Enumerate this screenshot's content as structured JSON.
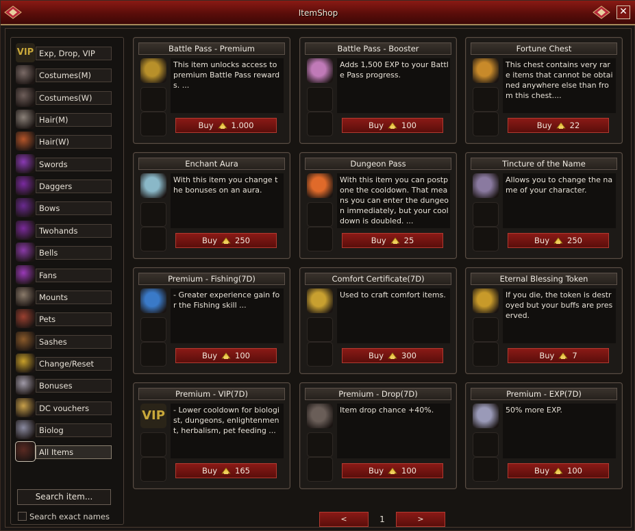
{
  "window": {
    "title": "ItemShop",
    "close_glyph": "✕"
  },
  "sidebar": {
    "categories": [
      {
        "label": "Exp, Drop, VIP",
        "icon": "vip-icon",
        "color": "#c9a83a",
        "text": "VIP"
      },
      {
        "label": "Costumes(M)",
        "icon": "costume-male-icon",
        "color": "#7a6a66"
      },
      {
        "label": "Costumes(W)",
        "icon": "costume-female-icon",
        "color": "#6e5e5a"
      },
      {
        "label": "Hair(M)",
        "icon": "hair-male-icon",
        "color": "#8a8078"
      },
      {
        "label": "Hair(W)",
        "icon": "hair-female-icon",
        "color": "#b4552a"
      },
      {
        "label": "Swords",
        "icon": "sword-icon",
        "color": "#8a3ab4"
      },
      {
        "label": "Daggers",
        "icon": "dagger-icon",
        "color": "#7a2aa0"
      },
      {
        "label": "Bows",
        "icon": "bow-icon",
        "color": "#6a2a90"
      },
      {
        "label": "Twohands",
        "icon": "twohand-icon",
        "color": "#7a2a9a"
      },
      {
        "label": "Bells",
        "icon": "bell-icon",
        "color": "#8a3aa8"
      },
      {
        "label": "Fans",
        "icon": "fan-icon",
        "color": "#9a3ab8"
      },
      {
        "label": "Mounts",
        "icon": "mount-icon",
        "color": "#8a7a6a"
      },
      {
        "label": "Pets",
        "icon": "pet-icon",
        "color": "#9a4030"
      },
      {
        "label": "Sashes",
        "icon": "sash-icon",
        "color": "#8a5a2a"
      },
      {
        "label": "Change/Reset",
        "icon": "change-reset-icon",
        "color": "#c8a02a"
      },
      {
        "label": "Bonuses",
        "icon": "bonus-icon",
        "color": "#a09aa8"
      },
      {
        "label": "DC vouchers",
        "icon": "voucher-icon",
        "color": "#c8a04a"
      },
      {
        "label": "Biolog",
        "icon": "biolog-icon",
        "color": "#8a8aa0"
      },
      {
        "label": "All Items",
        "icon": "all-items-icon",
        "color": "#5a2a22"
      }
    ],
    "active_index": 18,
    "search_button": "Search item...",
    "exact_names_label": "Search exact names"
  },
  "items": [
    {
      "name": "Battle Pass - Premium",
      "desc": "This item unlocks access to premium Battle Pass rewards. ...",
      "price": "1.000",
      "icon": "battle-pass-premium-icon",
      "color": "#b8902a"
    },
    {
      "name": "Battle Pass - Booster",
      "desc": "Adds 1,500 EXP to your Battle Pass progress.",
      "price": "100",
      "icon": "battle-pass-booster-icon",
      "color": "#c07ab8"
    },
    {
      "name": "Fortune Chest",
      "desc": "This chest contains very rare items that cannot be obtained anywhere else than from this chest....",
      "price": "22",
      "icon": "fortune-chest-icon",
      "color": "#c88a2a"
    },
    {
      "name": "Enchant Aura",
      "desc": "With this item you change the bonuses on an aura.",
      "price": "250",
      "icon": "enchant-aura-icon",
      "color": "#8ab8c8"
    },
    {
      "name": "Dungeon Pass",
      "desc": "With this item you can postpone the cooldown. That means you can enter the dungeon immediately, but your cooldown is doubled. ...",
      "price": "25",
      "icon": "dungeon-pass-icon",
      "color": "#e06a2a"
    },
    {
      "name": "Tincture of the Name",
      "desc": "Allows you to change the name of your character.",
      "price": "250",
      "icon": "tincture-icon",
      "color": "#8a7aa0"
    },
    {
      "name": "Premium - Fishing(7D)",
      "desc": "- Greater experience gain for the Fishing skill ...",
      "price": "100",
      "icon": "fishing-orb-icon",
      "color": "#3a7ac8"
    },
    {
      "name": "Comfort Certificate(7D)",
      "desc": "Used to craft comfort items.",
      "price": "300",
      "icon": "comfort-certificate-icon",
      "color": "#c8a030"
    },
    {
      "name": "Eternal Blessing Token",
      "desc": "If you die, the token is destroyed but your buffs are preserved.",
      "price": "7",
      "icon": "blessing-shield-icon",
      "color": "#c89a2a"
    },
    {
      "name": "Premium - VIP(7D)",
      "desc": "- Lower cooldown for biologist, dungeons, enlightenment, herbalism, pet feeding ...",
      "price": "165",
      "icon": "vip-icon",
      "color": "#c9a83a",
      "text": "VIP"
    },
    {
      "name": "Premium - Drop(7D)",
      "desc": "Item drop chance +40%.",
      "price": "100",
      "icon": "drop-claw-icon",
      "color": "#6a5e58"
    },
    {
      "name": "Premium - EXP(7D)",
      "desc": "50% more EXP.",
      "price": "100",
      "icon": "exp-ring-icon",
      "color": "#9a9ab8"
    }
  ],
  "buy_label": "Buy",
  "pager": {
    "prev": "<",
    "page": "1",
    "next": ">"
  }
}
